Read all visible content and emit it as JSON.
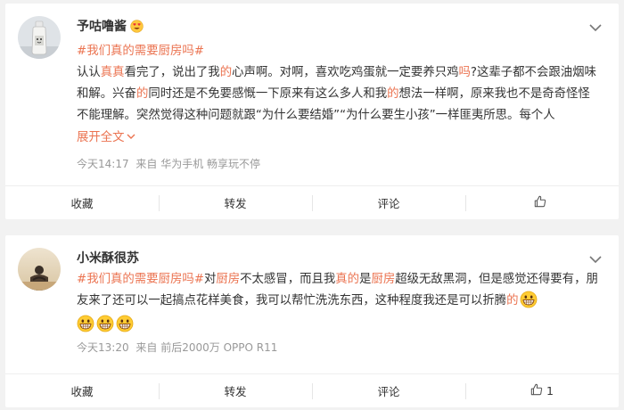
{
  "posts": [
    {
      "username": "予咕噜酱",
      "badge_icon": "heart-eyes-emoji",
      "topic": "#我们真的需要厨房吗#",
      "text_segments": [
        {
          "t": "认认",
          "hl": false
        },
        {
          "t": "真真",
          "hl": true
        },
        {
          "t": "看完了，说出了我",
          "hl": false
        },
        {
          "t": "的",
          "hl": true
        },
        {
          "t": "心声啊。对啊，喜欢吃鸡蛋就一定要养只鸡",
          "hl": false
        },
        {
          "t": "吗",
          "hl": true
        },
        {
          "t": "?这辈子都不会跟油烟味和解。兴奋",
          "hl": false
        },
        {
          "t": "的",
          "hl": true
        },
        {
          "t": "同时还是不免要感慨一下原来有这么多人和我",
          "hl": false
        },
        {
          "t": "的",
          "hl": true
        },
        {
          "t": "想法一样啊，原来我也不是奇奇怪怪不能理解。突然觉得这种问题就跟“为什么要结婚”“为什么要生小孩”一样匪夷所思。每个人",
          "hl": false
        }
      ],
      "expand_label": "展开全文",
      "time": "今天14:17",
      "source": "来自 华为手机 畅享玩不停",
      "actions": {
        "collect": "收藏",
        "repost": "转发",
        "comment": "评论",
        "like_count": ""
      }
    },
    {
      "username": "小米酥很苏",
      "topic": "#我们真的需要厨房吗#",
      "text_segments": [
        {
          "t": "对",
          "hl": false
        },
        {
          "t": "厨房",
          "hl": true
        },
        {
          "t": "不太感冒，而且我",
          "hl": false
        },
        {
          "t": "真的",
          "hl": true
        },
        {
          "t": "是",
          "hl": false
        },
        {
          "t": "厨房",
          "hl": true
        },
        {
          "t": "超级无敌黑洞，但是感觉还得要有，朋友来了还可以一起搞点花样美食，我可以帮忙洗洗东西，这种程度我还是可以折腾",
          "hl": false
        },
        {
          "t": "的",
          "hl": true
        }
      ],
      "emoji": "grin-emoji",
      "time": "今天13:20",
      "source": "来自 前后2000万 OPPO R11",
      "actions": {
        "collect": "收藏",
        "repost": "转发",
        "comment": "评论",
        "like_count": "1"
      }
    }
  ],
  "colors": {
    "accent": "#eb7350",
    "meta": "#999999",
    "background": "#f2f2f2"
  }
}
